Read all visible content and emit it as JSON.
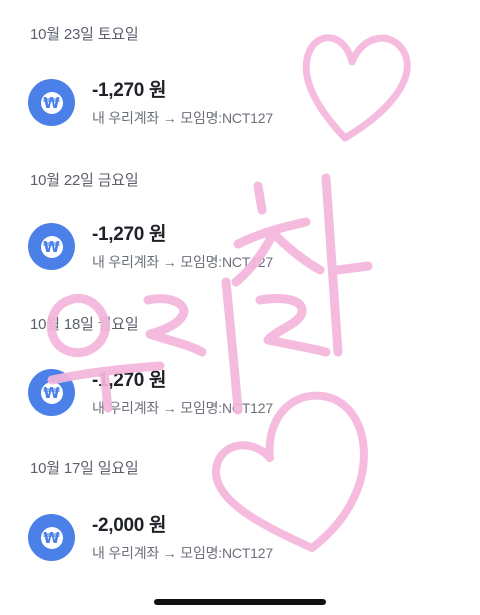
{
  "groups": [
    {
      "date": "10월 23일 토요일",
      "amount": "-1,270 원",
      "description": "내 우리계좌 → 모임명:NCT127",
      "icon": "won-icon"
    },
    {
      "date": "10월 22일 금요일",
      "amount": "-1,270 원",
      "description": "내 우리계좌 → 모임명:NCT127",
      "icon": "won-icon"
    },
    {
      "date": "10월 18일 월요일",
      "amount": "-1,270 원",
      "description": "내 우리계좌 → 모임명:NCT127",
      "icon": "won-icon"
    },
    {
      "date": "10월 17일 일요일",
      "amount": "-2,000 원",
      "description": "내 우리계좌 → 모임명:NCT127",
      "icon": "won-icon"
    }
  ],
  "won_symbol": "₩",
  "handwriting": {
    "text": "우리철",
    "color": "#f4b6dc"
  },
  "accent_color": "#4a80e8"
}
